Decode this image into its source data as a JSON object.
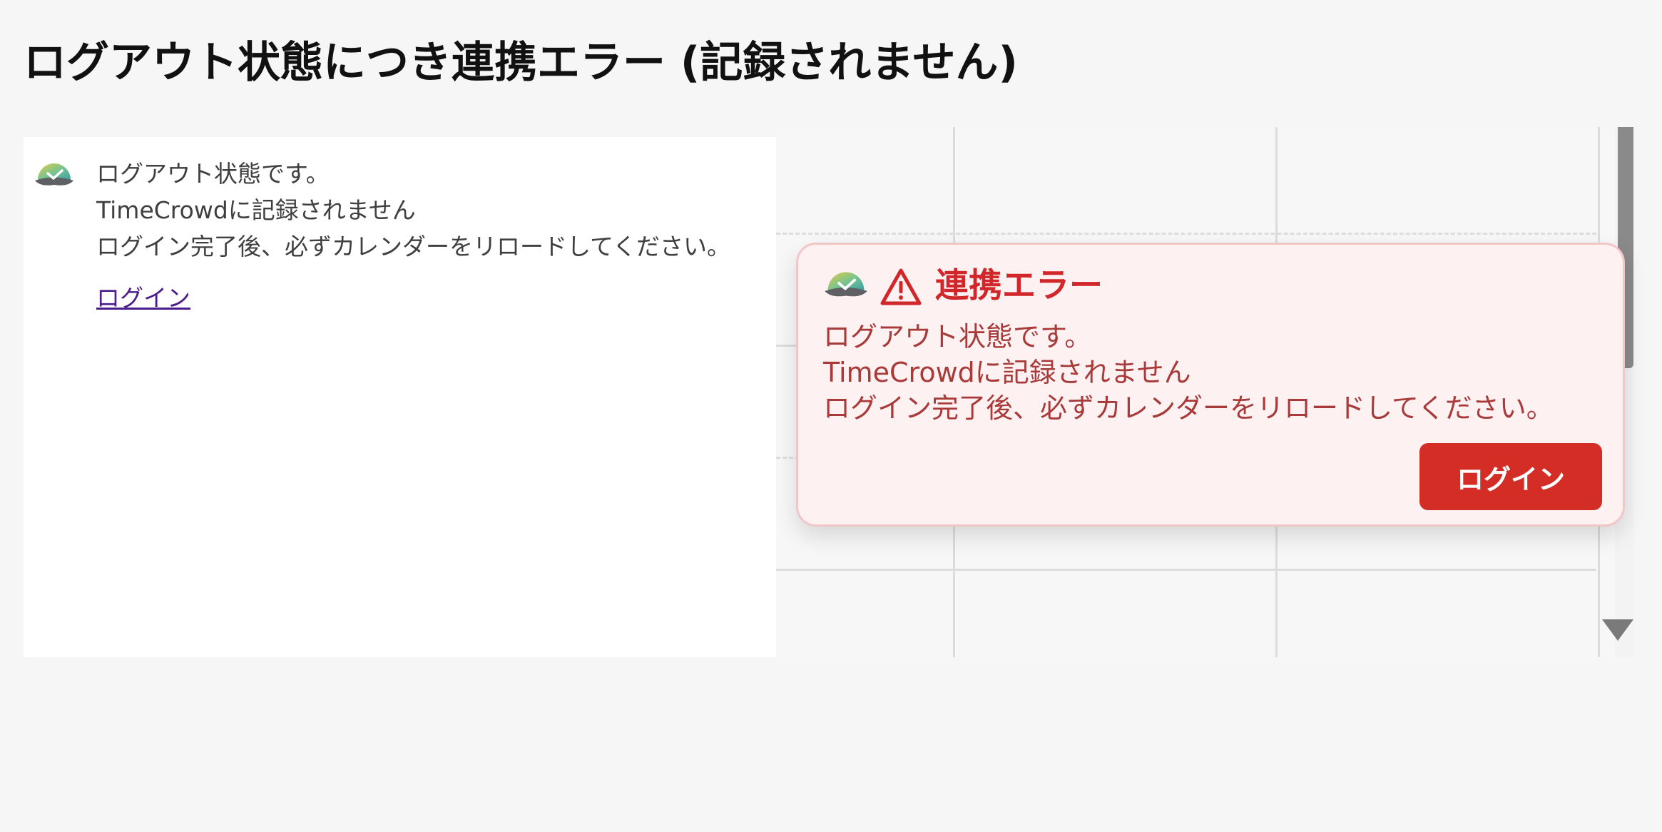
{
  "page": {
    "title": "ログアウト状態につき連携エラー (記録されません)"
  },
  "left_panel": {
    "logo_icon": "timecrowd-logo-icon",
    "message_lines": [
      "ログアウト状態です。",
      "TimeCrowdに記録されません",
      "ログイン完了後、必ずカレンダーをリロードしてください。"
    ],
    "login_link": "ログイン"
  },
  "error_card": {
    "logo_icon": "timecrowd-logo-icon",
    "warning_icon": "warning-triangle-icon",
    "title": "連携エラー",
    "message_lines": [
      "ログアウト状態です。",
      "TimeCrowdに記録されません",
      "ログイン完了後、必ずカレンダーをリロードしてください。"
    ],
    "login_button": "ログイン"
  },
  "colors": {
    "page_background": "#f6f6f6",
    "card_background": "#fdf1f1",
    "card_border": "#f2c6c6",
    "error_red": "#d1272a",
    "button_red": "#d32d26",
    "message_text": "#a83a3a",
    "link_purple": "#4b1d8c"
  }
}
